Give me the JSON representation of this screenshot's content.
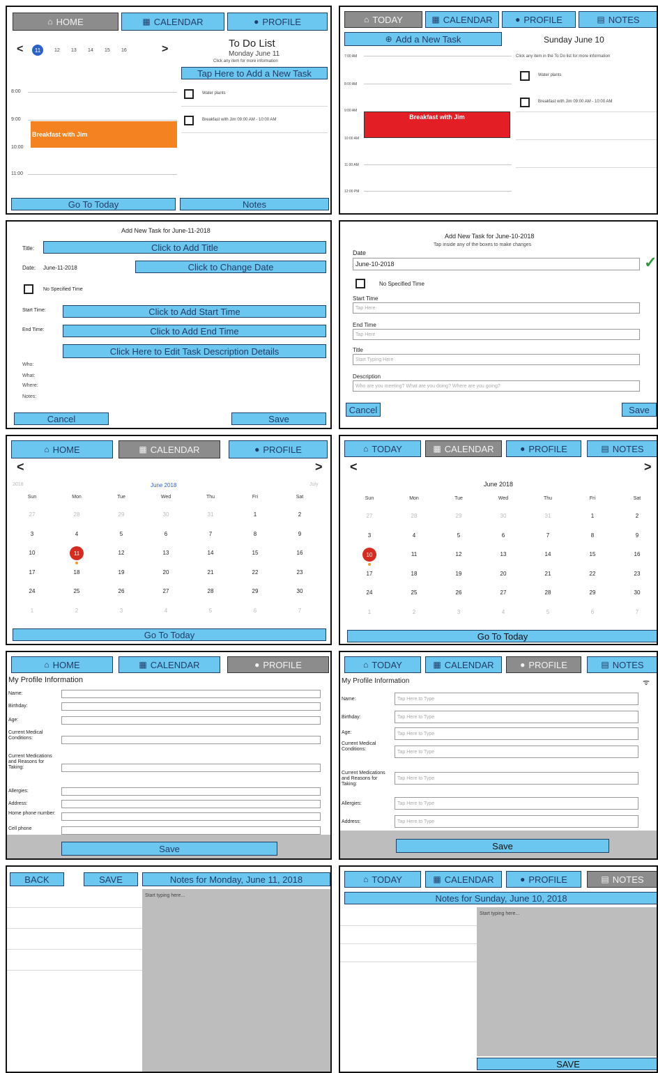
{
  "p1": {
    "nav": [
      "HOME",
      "CALENDAR",
      "PROFILE"
    ],
    "days": [
      "11",
      "12",
      "13",
      "14",
      "15",
      "16"
    ],
    "prev": "<",
    "next": ">",
    "title": "To Do List",
    "date": "Monday June 11",
    "hint": "Click any item for more information",
    "add": "Tap Here to Add a New Task",
    "times": [
      "8:00",
      "9:00",
      "10:00",
      "11:00"
    ],
    "event": "Breakfast with Jim",
    "tasks": [
      "Water plants",
      "Breakfast with Jim 09:00 AM - 10:00 AM"
    ],
    "today": "Go To Today",
    "notes": "Notes"
  },
  "p2": {
    "nav": [
      "TODAY",
      "CALENDAR",
      "PROFILE",
      "NOTES"
    ],
    "add": "Add a New Task",
    "date": "Sunday June 10",
    "hint": "Click any item in the To Do list for more information",
    "times": [
      "7:00 AM",
      "8:00 AM",
      "9:00 AM",
      "10:00 AM",
      "11:00 AM",
      "12:00 PM"
    ],
    "event": "Breakfast with Jim",
    "tasks": [
      "Water plants",
      "Breakfast with Jim 09:00 AM - 10:00 AM"
    ]
  },
  "p3": {
    "title": "Add New Task for June-11-2018",
    "rows": [
      {
        "label": "Title:",
        "btn": "Click to Add Title"
      },
      {
        "label": "Date:",
        "value": "June-11-2018",
        "btn": "Click to Change Date"
      },
      {
        "label": "Start Time:",
        "btn": "Click to Add Start Time"
      },
      {
        "label": "End Time:",
        "btn": "Click to Add End Time"
      }
    ],
    "nospec": "No Specified Time",
    "desc": "Click Here to Edit Task Description Details",
    "meta": [
      "Who:",
      "What:",
      "Where:",
      "Notes:"
    ],
    "cancel": "Cancel",
    "save": "Save"
  },
  "p4": {
    "title": "Add New Task for June-10-2018",
    "sub": "Tap inside any of the boxes to make changes",
    "date_label": "Date",
    "date": "June-10-2018",
    "nospec": "No Specified Time",
    "start": "Start Time",
    "start_ph": "Tap Here",
    "end": "End Time",
    "end_ph": "Tap Here",
    "title_label": "Title",
    "title_ph": "Start Typing Here",
    "desc_label": "Description",
    "desc_ph": "Who are you meeting? What are you doing? Where are you going?",
    "cancel": "Cancel",
    "save": "Save",
    "check": "✓"
  },
  "p5": {
    "nav": [
      "HOME",
      "CALENDAR",
      "PROFILE"
    ],
    "prev": "<",
    "next": ">",
    "month": "June 2018",
    "prevmonth": "2018",
    "nextmonth": "July",
    "dow": [
      "Sun",
      "Mon",
      "Tue",
      "Wed",
      "Thu",
      "Fri",
      "Sat"
    ],
    "weeks": [
      [
        "27",
        "28",
        "29",
        "30",
        "31",
        "1",
        "2"
      ],
      [
        "3",
        "4",
        "5",
        "6",
        "7",
        "8",
        "9"
      ],
      [
        "10",
        "11",
        "12",
        "13",
        "14",
        "15",
        "16"
      ],
      [
        "17",
        "18",
        "19",
        "20",
        "21",
        "22",
        "23"
      ],
      [
        "24",
        "25",
        "26",
        "27",
        "28",
        "29",
        "30"
      ],
      [
        "1",
        "2",
        "3",
        "4",
        "5",
        "6",
        "7"
      ]
    ],
    "today": "Go To Today"
  },
  "p6": {
    "nav": [
      "TODAY",
      "CALENDAR",
      "PROFILE",
      "NOTES"
    ],
    "prev": "<",
    "next": ">",
    "month": "June 2018",
    "dow": [
      "Sun",
      "Mon",
      "Tue",
      "Wed",
      "Thu",
      "Fri",
      "Sat"
    ],
    "weeks": [
      [
        "27",
        "28",
        "29",
        "30",
        "31",
        "1",
        "2"
      ],
      [
        "3",
        "4",
        "5",
        "6",
        "7",
        "8",
        "9"
      ],
      [
        "10",
        "11",
        "12",
        "13",
        "14",
        "15",
        "16"
      ],
      [
        "17",
        "18",
        "19",
        "20",
        "21",
        "22",
        "23"
      ],
      [
        "24",
        "25",
        "26",
        "27",
        "28",
        "29",
        "30"
      ],
      [
        "1",
        "2",
        "3",
        "4",
        "5",
        "6",
        "7"
      ]
    ],
    "today": "Go To Today"
  },
  "p7": {
    "nav": [
      "HOME",
      "CALENDAR",
      "PROFILE"
    ],
    "title": "My Profile Information",
    "fields": [
      "Name:",
      "Birthday:",
      "Age:",
      "Current Medical Conditions:",
      "Current Medications and Reasons for Taking:",
      "Allergies:",
      "Address:",
      "Home phone number:",
      "Cell phone"
    ],
    "save": "Save"
  },
  "p8": {
    "nav": [
      "TODAY",
      "CALENDAR",
      "PROFILE",
      "NOTES"
    ],
    "title": "My Profile Information",
    "fields": [
      "Name:",
      "Birthday:",
      "Age:",
      "Current Medical Conditions:",
      "Current Medications and Reasons for Taking:",
      "Allergies:",
      "Address:"
    ],
    "ph": "Tap Here to Type",
    "save": "Save"
  },
  "p9": {
    "back": "BACK",
    "save": "SAVE",
    "title": "Notes for Monday, June 11, 2018",
    "ph": "Start typing here..."
  },
  "p10": {
    "nav": [
      "TODAY",
      "CALENDAR",
      "PROFILE",
      "NOTES"
    ],
    "title": "Notes for Sunday, June 10, 2018",
    "ph": "Start typing here...",
    "save": "SAVE"
  },
  "colors": {
    "button": "#6cc7f0",
    "selected": "#8c8c8c",
    "event_orange": "#f58220",
    "event_red": "#e31e24",
    "marker": "#d62b1f"
  }
}
